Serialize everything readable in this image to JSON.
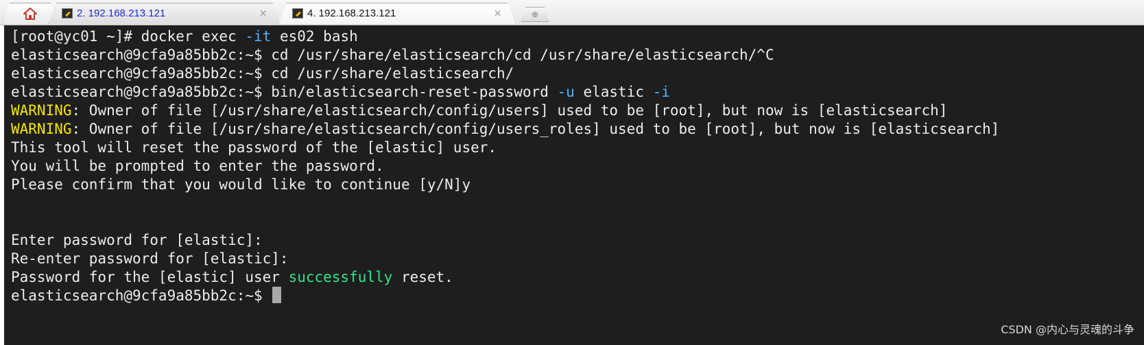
{
  "tabs": [
    {
      "label": "2. 192.168.213.121",
      "close": "×",
      "active": false
    },
    {
      "label": "4. 192.168.213.121",
      "close": "×",
      "active": true
    }
  ],
  "new_tab_symbol": "⊕",
  "terminal": {
    "lines": [
      {
        "segments": [
          "[root@yc01 ~]# docker exec ",
          "-it",
          " es02 bash"
        ]
      },
      {
        "segments": [
          "elasticsearch@9cfa9a85bb2c:~$ cd /usr/share/elasticsearch/cd /usr/share/elasticsearch/^C"
        ]
      },
      {
        "segments": [
          "elasticsearch@9cfa9a85bb2c:~$ cd /usr/share/elasticsearch/"
        ]
      },
      {
        "segments": [
          "elasticsearch@9cfa9a85bb2c:~$ bin/elasticsearch-reset-password ",
          "-u",
          " elastic ",
          "-i"
        ]
      },
      {
        "segments": [
          "WARNING",
          ": Owner of file [/usr/share/elasticsearch/config/users] used to be [root], but now is [elasticsearch]"
        ]
      },
      {
        "segments": [
          "WARNING",
          ": Owner of file [/usr/share/elasticsearch/config/users_roles] used to be [root], but now is [elasticsearch]"
        ]
      },
      {
        "segments": [
          "This tool will reset the password of the [elastic] user."
        ]
      },
      {
        "segments": [
          "You will be prompted to enter the password."
        ]
      },
      {
        "segments": [
          "Please confirm that you would like to continue [y/N]y"
        ]
      },
      {
        "segments": [
          ""
        ]
      },
      {
        "segments": [
          ""
        ]
      },
      {
        "segments": [
          "Enter password for [elastic]:"
        ]
      },
      {
        "segments": [
          "Re-enter password for [elastic]:"
        ]
      },
      {
        "segments": [
          "Password for the [elastic] user ",
          "successfully",
          " reset."
        ]
      },
      {
        "segments": [
          "elasticsearch@9cfa9a85bb2c:~$ "
        ]
      }
    ]
  },
  "colors": {
    "background": "#1e1e1e",
    "text": "#ededed",
    "option_flag": "#4fb3ff",
    "warning": "#f5e500",
    "success": "#31e58a"
  },
  "watermark": "CSDN @内心与灵魂的斗争"
}
